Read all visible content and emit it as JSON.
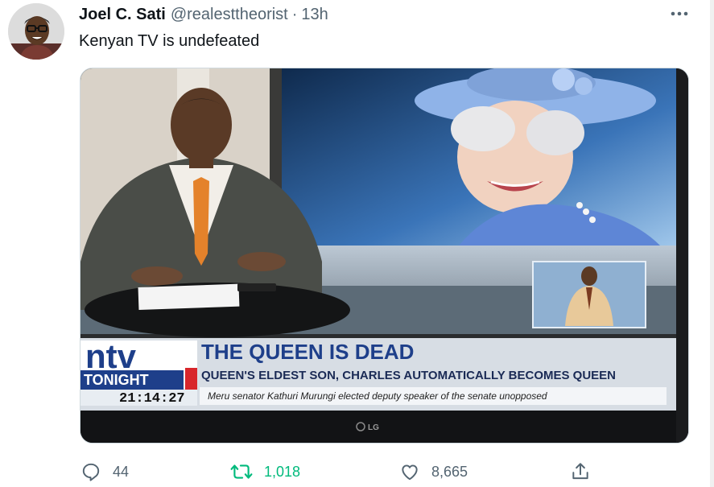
{
  "author": {
    "display_name": "Joel C. Sati",
    "handle": "@realesttheorist",
    "separator": "·",
    "timestamp": "13h"
  },
  "tweet": {
    "text": "Kenyan TV is undefeated"
  },
  "media": {
    "description_icon": "tv-broadcast-photo",
    "brand_logo": "ntv",
    "program": "TONIGHT",
    "clock": "21:14:27",
    "headline": "THE QUEEN IS DEAD",
    "subheadline": "QUEEN'S ELDEST SON, CHARLES AUTOMATICALLY BECOMES QUEEN",
    "ticker": "Meru senator Kathuri Murungi elected deputy speaker of the senate unopposed",
    "tv_brand": "LG"
  },
  "actions": {
    "replies": "44",
    "retweets": "1,018",
    "likes": "8,665"
  },
  "colors": {
    "text": "#0f1419",
    "secondary": "#536471",
    "retweet_green": "#00ba7c",
    "ntv_red": "#d8262b",
    "banner_blue": "#1e3f8a"
  }
}
